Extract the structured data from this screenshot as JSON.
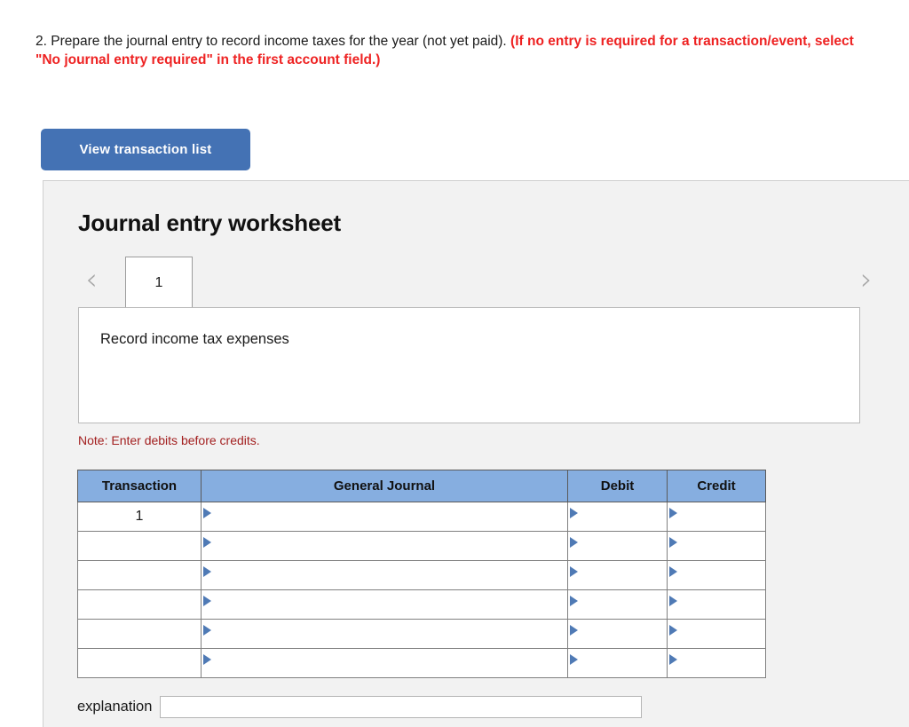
{
  "question": {
    "number": "2.",
    "text": "Prepare the journal entry to record income taxes for the year (not yet paid).",
    "emphasis": "(If no entry is required for a transaction/event, select \"No journal entry required\" in the first account field.)",
    "emphasis_color": "#ee2222"
  },
  "toolbar": {
    "view_transaction_list_label": "View transaction list",
    "button_color": "#4472b4"
  },
  "worksheet": {
    "title": "Journal entry worksheet",
    "prev_icon": "chevron-left-icon",
    "next_icon": "chevron-right-icon",
    "tabs": [
      {
        "label": "1",
        "selected": true
      }
    ],
    "description": "Record income tax expenses",
    "note": "Note: Enter debits before credits.",
    "note_color": "#a32020"
  },
  "journal_table": {
    "header_color": "#86aee0",
    "columns": [
      "Transaction",
      "General Journal",
      "Debit",
      "Credit"
    ],
    "rows": [
      {
        "transaction": "1",
        "general_journal": "",
        "debit": "",
        "credit": ""
      },
      {
        "transaction": "",
        "general_journal": "",
        "debit": "",
        "credit": ""
      },
      {
        "transaction": "",
        "general_journal": "",
        "debit": "",
        "credit": ""
      },
      {
        "transaction": "",
        "general_journal": "",
        "debit": "",
        "credit": ""
      },
      {
        "transaction": "",
        "general_journal": "",
        "debit": "",
        "credit": ""
      },
      {
        "transaction": "",
        "general_journal": "",
        "debit": "",
        "credit": ""
      }
    ]
  },
  "explanation": {
    "label": "explanation",
    "value": "",
    "placeholder": ""
  }
}
